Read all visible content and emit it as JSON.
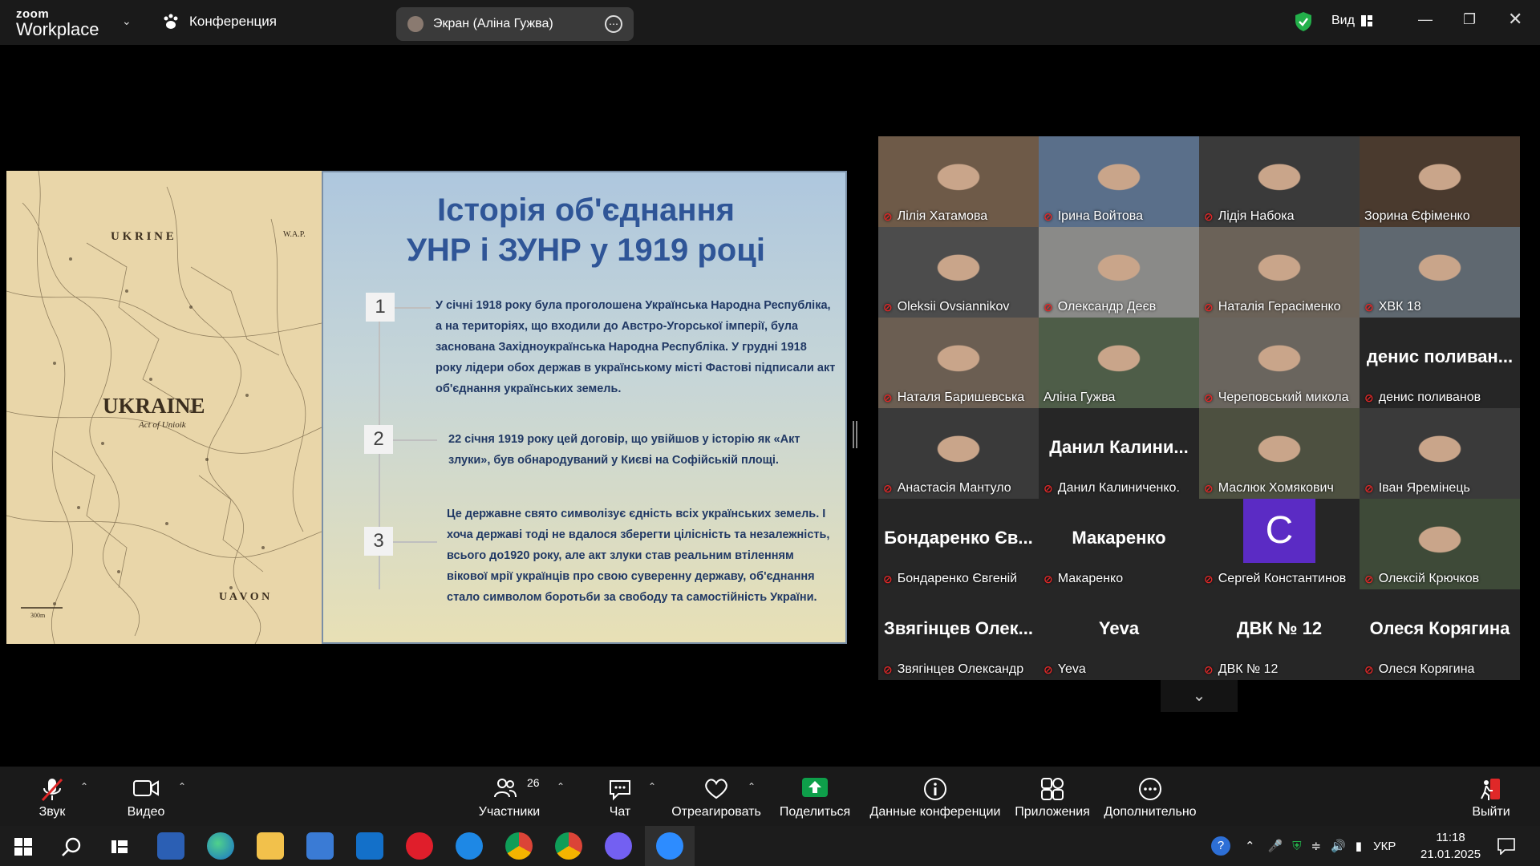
{
  "app": {
    "logo_line1": "zoom",
    "logo_line2": "Workplace",
    "conference_label": "Конференция",
    "screen_share_label": "Экран (Аліна Гужва)",
    "view_label": "Вид",
    "accent_green": "#23d18b"
  },
  "slide": {
    "title_line1": "Історія об'єднання",
    "title_line2": "УНР і ЗУНР у 1919 році",
    "map_labels": {
      "ukrine": "U K R I N E",
      "wap": "W.A.P.",
      "ukraine": "UKRAINE",
      "act": "Act of Unioik",
      "uavon": "U A V O N",
      "scale": "300m"
    },
    "items": [
      {
        "num": "1",
        "lines": [
          "У січні 1918 року була проголошена Українська Народна Республіка,",
          "а на територіях, що входили до Австро-Угорської імперії, була",
          "заснована Західноукраїнська Народна Республіка. У грудні 1918",
          "року лідери обох держав в українському місті Фастові підписали акт",
          "об'єднання українських земель."
        ]
      },
      {
        "num": "2",
        "lines": [
          "22 січня 1919 року цей договір, що увійшов у історію як «Акт",
          "злуки», був обнародуваний у Києві на Софійській площі."
        ]
      },
      {
        "num": "3",
        "lines": [
          "Це державне свято символізує єдність всіх українських земель. І",
          "хоча державі тоді не вдалося зберегти цілісність та незалежність,",
          "всього до1920 року, але акт злуки став реальним втіленням",
          "вікової мрії українців про свою суверенну державу, об'єднання",
          "стало символом боротьби за свободу та самостійність України."
        ]
      }
    ]
  },
  "participants": [
    {
      "label": "Лілія Хатамова",
      "big": "",
      "muted": true,
      "video": true
    },
    {
      "label": "Ірина Войтова",
      "big": "",
      "muted": true,
      "video": true
    },
    {
      "label": "Лідія Набока",
      "big": "",
      "muted": true,
      "video": true
    },
    {
      "label": "Зорина Єфіменко",
      "big": "",
      "muted": false,
      "video": true
    },
    {
      "label": "Oleksii Ovsiannikov",
      "big": "",
      "muted": true,
      "video": true
    },
    {
      "label": "Олександр Деєв",
      "big": "",
      "muted": true,
      "video": true
    },
    {
      "label": "Наталія Герасіменко",
      "big": "",
      "muted": true,
      "video": true
    },
    {
      "label": "ХВК 18",
      "big": "",
      "muted": true,
      "video": true
    },
    {
      "label": "Наталя Баришевська",
      "big": "",
      "muted": true,
      "video": true
    },
    {
      "label": "Аліна Гужва",
      "big": "",
      "muted": false,
      "video": true,
      "active": true
    },
    {
      "label": "Череповський микола",
      "big": "",
      "muted": true,
      "video": true
    },
    {
      "label": "денис поливанов",
      "big": "денис поливан...",
      "muted": true,
      "video": false
    },
    {
      "label": "Анастасія Мантуло",
      "big": "",
      "muted": true,
      "video": true
    },
    {
      "label": "Данил Калиниченко.",
      "big": "Данил Калини...",
      "muted": true,
      "video": false
    },
    {
      "label": "Маслюк Хомякович",
      "big": "",
      "muted": true,
      "video": true
    },
    {
      "label": "Іван Яремінець",
      "big": "",
      "muted": true,
      "video": true
    },
    {
      "label": "Бондаренко Євгеній",
      "big": "Бондаренко Єв...",
      "muted": true,
      "video": false
    },
    {
      "label": "Макаренко",
      "big": "Макаренко",
      "muted": true,
      "video": false
    },
    {
      "label": "Сергей Константинов",
      "big": "",
      "muted": true,
      "video": false,
      "avatar": "C"
    },
    {
      "label": "Олексій Крючков",
      "big": "",
      "muted": true,
      "video": true
    },
    {
      "label": "Звягінцев Олександр",
      "big": "Звягінцев Олек...",
      "muted": true,
      "video": false
    },
    {
      "label": "Yeva",
      "big": "Yeva",
      "muted": true,
      "video": false
    },
    {
      "label": "ДВК № 12",
      "big": "ДВК № 12",
      "muted": true,
      "video": false
    },
    {
      "label": "Олеся Корягина",
      "big": "Олеся Корягина",
      "muted": true,
      "video": false
    }
  ],
  "toolbar": {
    "audio": "Звук",
    "video": "Видео",
    "participants": "Участники",
    "participants_count": "26",
    "chat": "Чат",
    "react": "Отреагировать",
    "share": "Поделиться",
    "info": "Данные конференции",
    "apps": "Приложения",
    "more": "Дополнительно",
    "leave": "Выйти"
  },
  "taskbar": {
    "lang": "УКР",
    "time": "11:18",
    "date": "21.01.2025"
  }
}
